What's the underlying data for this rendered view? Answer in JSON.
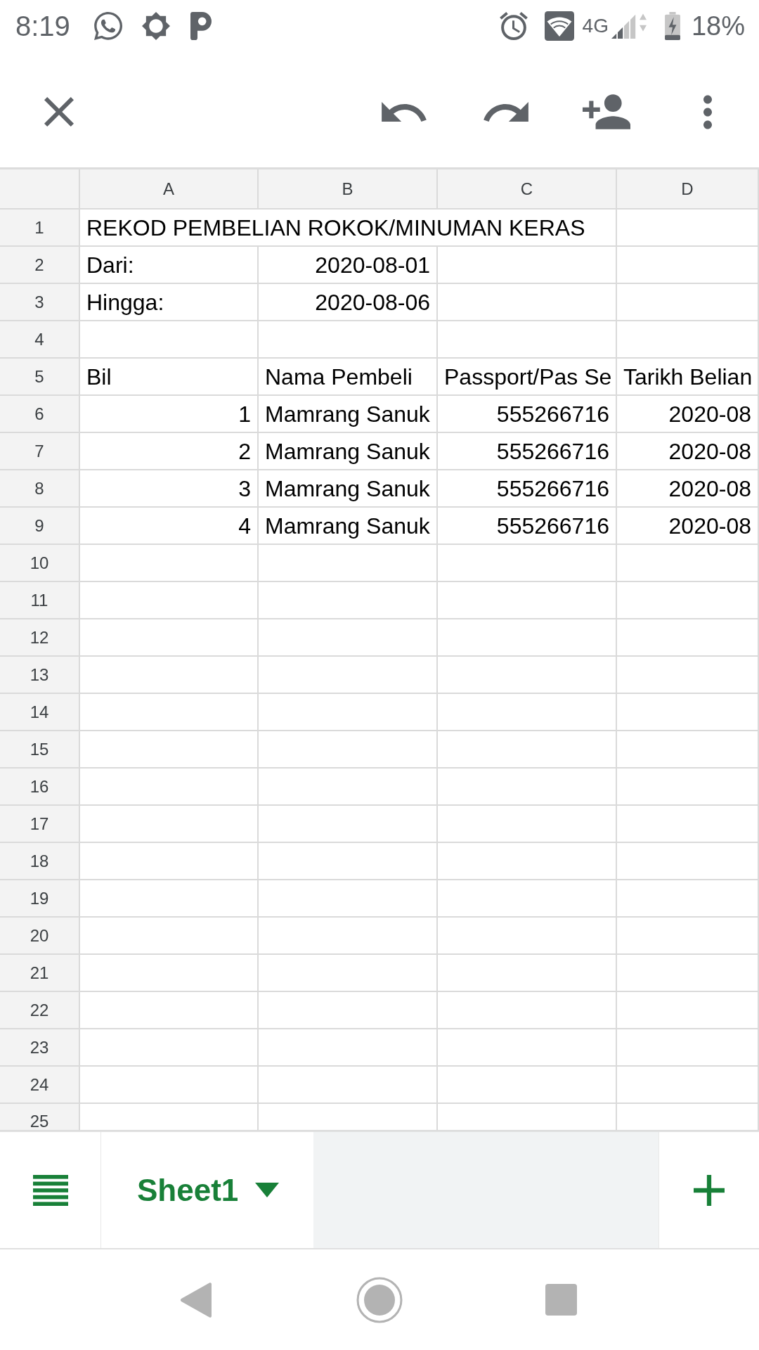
{
  "status_bar": {
    "time": "8:19",
    "network": "4G",
    "battery": "18%"
  },
  "sheet": {
    "columns": [
      "A",
      "B",
      "C",
      "D"
    ],
    "rows": [
      {
        "number": "1",
        "cells": [
          {
            "text": "REKOD PEMBELIAN ROKOK/MINUMAN KERAS",
            "kind": "text",
            "overflow": true
          },
          null,
          null,
          null
        ]
      },
      {
        "number": "2",
        "cells": [
          {
            "text": "Dari:",
            "kind": "text"
          },
          {
            "text": "2020-08-01",
            "kind": "date"
          },
          null,
          null
        ]
      },
      {
        "number": "3",
        "cells": [
          {
            "text": "Hingga:",
            "kind": "text"
          },
          {
            "text": "2020-08-06",
            "kind": "date"
          },
          null,
          null
        ]
      },
      {
        "number": "4"
      },
      {
        "number": "5",
        "cells": [
          {
            "text": "Bil",
            "kind": "text"
          },
          {
            "text": "Nama Pembeli",
            "kind": "text"
          },
          {
            "text": "Passport/Pas Se",
            "kind": "text"
          },
          {
            "text": "Tarikh Belian",
            "kind": "text"
          }
        ]
      },
      {
        "number": "6",
        "cells": [
          {
            "text": "1",
            "kind": "number"
          },
          {
            "text": "Mamrang Sanuk",
            "kind": "text"
          },
          {
            "text": "555266716",
            "kind": "number"
          },
          {
            "text": "2020-08",
            "kind": "date"
          }
        ]
      },
      {
        "number": "7",
        "cells": [
          {
            "text": "2",
            "kind": "number"
          },
          {
            "text": "Mamrang Sanuk",
            "kind": "text"
          },
          {
            "text": "555266716",
            "kind": "number"
          },
          {
            "text": "2020-08",
            "kind": "date"
          }
        ]
      },
      {
        "number": "8",
        "cells": [
          {
            "text": "3",
            "kind": "number"
          },
          {
            "text": "Mamrang Sanuk",
            "kind": "text"
          },
          {
            "text": "555266716",
            "kind": "number"
          },
          {
            "text": "2020-08",
            "kind": "date"
          }
        ]
      },
      {
        "number": "9",
        "cells": [
          {
            "text": "4",
            "kind": "number"
          },
          {
            "text": "Mamrang Sanuk",
            "kind": "text"
          },
          {
            "text": "555266716",
            "kind": "number"
          },
          {
            "text": "2020-08",
            "kind": "date"
          }
        ]
      },
      {
        "number": "10"
      },
      {
        "number": "11"
      },
      {
        "number": "12"
      },
      {
        "number": "13"
      },
      {
        "number": "14"
      },
      {
        "number": "15"
      },
      {
        "number": "16"
      },
      {
        "number": "17"
      },
      {
        "number": "18"
      },
      {
        "number": "19"
      },
      {
        "number": "20"
      },
      {
        "number": "21"
      },
      {
        "number": "22"
      },
      {
        "number": "23"
      },
      {
        "number": "24"
      },
      {
        "number": "25"
      }
    ]
  },
  "sheet_tabs": [
    {
      "label": "Sheet1",
      "selected": true
    }
  ]
}
